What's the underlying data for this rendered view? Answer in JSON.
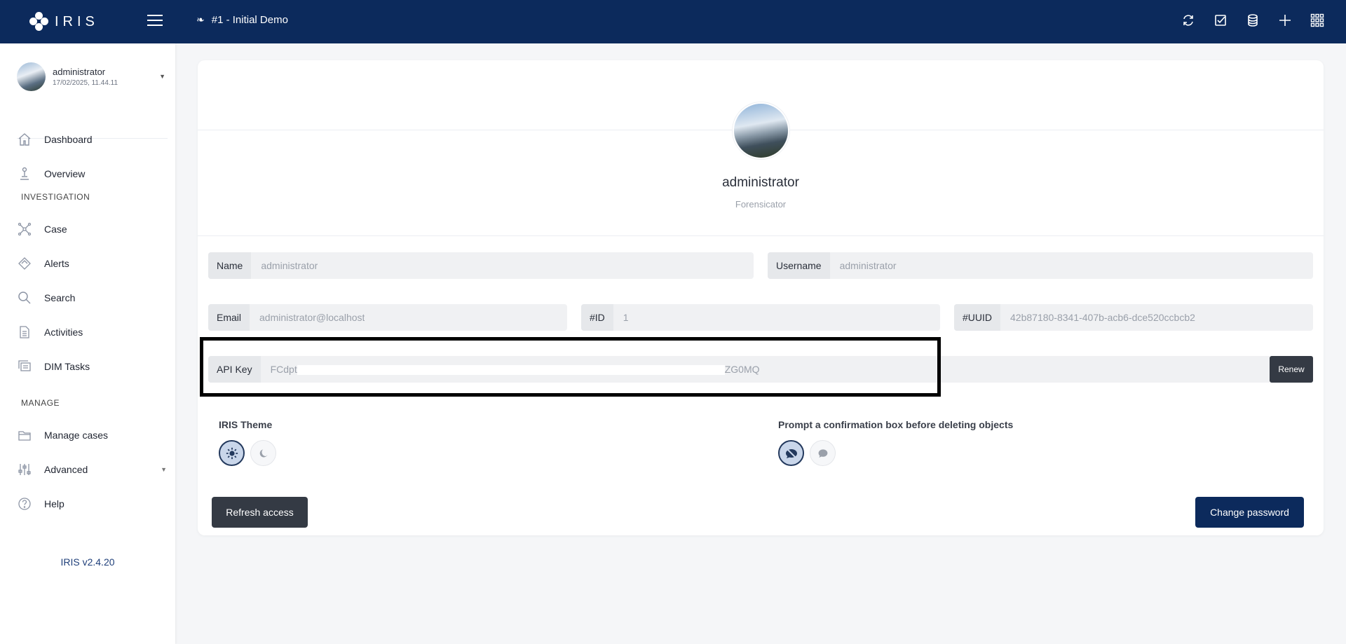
{
  "brand": {
    "name": "IRIS"
  },
  "header": {
    "case_title": "#1 - Initial Demo",
    "icons": [
      "sync-icon",
      "checkbox-icon",
      "database-icon",
      "plus-icon",
      "grid-icon"
    ]
  },
  "sidebar": {
    "user": {
      "name": "administrator",
      "date": "17/02/2025, 11.44.11"
    },
    "items": [
      {
        "label": "Dashboard",
        "icon": "home-icon"
      },
      {
        "label": "Overview",
        "icon": "overview-icon"
      },
      {
        "label": "Case",
        "icon": "network-icon"
      },
      {
        "label": "Alerts",
        "icon": "bell-icon"
      },
      {
        "label": "Search",
        "icon": "search-icon"
      },
      {
        "label": "Activities",
        "icon": "file-icon"
      },
      {
        "label": "DIM Tasks",
        "icon": "tasks-icon"
      },
      {
        "label": "Manage cases",
        "icon": "folder-icon"
      },
      {
        "label": "Advanced",
        "icon": "sliders-icon"
      },
      {
        "label": "Help",
        "icon": "help-icon"
      }
    ],
    "sections": {
      "investigation": "INVESTIGATION",
      "manage": "MANAGE"
    },
    "version": "IRIS v2.4.20"
  },
  "profile": {
    "name": "administrator",
    "role": "Forensicator",
    "fields": {
      "name": {
        "label": "Name",
        "value": "administrator"
      },
      "username": {
        "label": "Username",
        "value": "administrator"
      },
      "email": {
        "label": "Email",
        "value": "administrator@localhost"
      },
      "id": {
        "label": "#ID",
        "value": "1"
      },
      "uuid": {
        "label": "#UUID",
        "value": "42b87180-8341-407b-acb6-dce520ccbcb2"
      },
      "api_key": {
        "label": "API Key",
        "value_start": "FCdpt",
        "value_end": "ZG0MQ"
      }
    },
    "renew_label": "Renew",
    "theme_label": "IRIS Theme",
    "confirm_label": "Prompt a confirmation box before deleting objects",
    "refresh_label": "Refresh access",
    "change_password_label": "Change password"
  },
  "colors": {
    "header": "#0c2a5c",
    "accent": "#0c2a5c",
    "dark_button": "#343a44"
  }
}
